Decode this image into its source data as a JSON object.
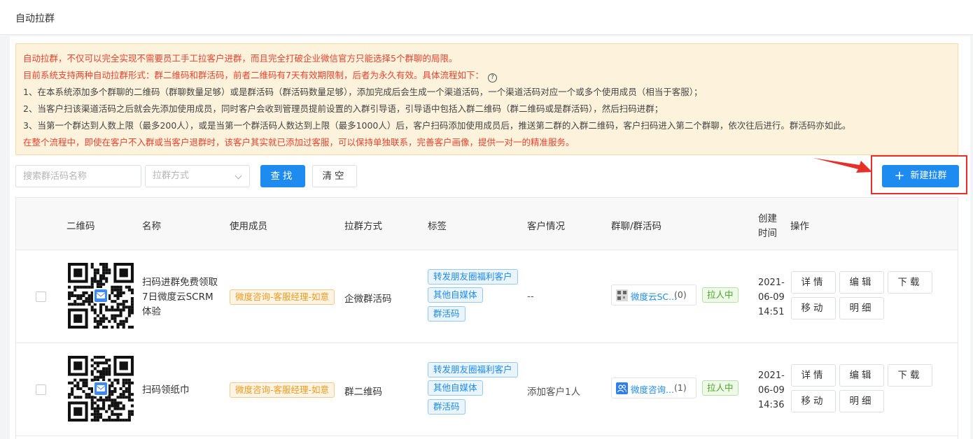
{
  "page": {
    "title": "自动拉群"
  },
  "notice": {
    "line1": "自动拉群，不仅可以完全实现不需要员工手工拉客户进群，而且完全打破企业微信官方只能选择5个群聊的局限。",
    "line2": "目前系统支持两种自动拉群形式：群二维码和群活码，前者二维码有7天有效期限制，后者为永久有效。具体流程如下：",
    "help_icon": "?",
    "line3": "1、在本系统添加多个群聊的二维码（群聊数量足够）或是群活码（群活码数量足够），添加完成后会生成一个渠道活码，一个渠道活码对应一个或多个使用成员（相当于客服）；",
    "line4": "2、当客户扫该渠道活码之后就会先添加使用成员，同时客户会收到管理员提前设置的入群引导语，引导语中包括入群二维码（群二维码或是群活码），然后扫码进群；",
    "line5": "3、当第一个群达到人数上限（最多200人），或是当第一个群活码人数达到上限（最多1000人）后，客户扫码添加使用成员后，推送第二群的入群二维码，客户扫码进入第二个群聊，依次往后进行。群活码亦如此。",
    "line6": "在整个流程中，即使在客户不入群或当客户退群时，该客户其实就已添加过客服，可以保持单独联系，完善客户画像，提供一对一的精准服务。",
    "colors": {
      "red": "#e8432e",
      "background": "#fdf2dc"
    }
  },
  "filters": {
    "search_placeholder": "搜索群活码名称",
    "method_placeholder": "拉群方式",
    "find_label": "查找",
    "clear_label": "清空",
    "new_label": "新建拉群"
  },
  "table": {
    "headers": {
      "qrcode": "二维码",
      "name": "名称",
      "members": "使用成员",
      "method": "拉群方式",
      "tags": "标签",
      "customer": "客户情况",
      "group": "群聊/群活码",
      "created_line1": "创建",
      "created_line2": "时间",
      "actions": "操作"
    },
    "rows": [
      {
        "name_line1": "扫码进群免费领取",
        "name_line2": "7日微度云SCRM",
        "name_line3": "体验",
        "member": "微度咨询-客服经理-如意",
        "method": "企微群活码",
        "tags": [
          "转发朋友圈福利客户",
          "其他自媒体",
          "群活码"
        ],
        "customer": "--",
        "group_name": "微度云SC...",
        "group_count": "(0)",
        "group_icon": "qr-thumbnail-icon",
        "status": "拉人中",
        "date_year": "2021-",
        "date_md": "06-09",
        "date_time": "14:51",
        "actions": [
          "详情",
          "编辑",
          "下载",
          "移动",
          "明细"
        ]
      },
      {
        "name_line1": "扫码领纸巾",
        "member": "微度咨询-客服经理-如意",
        "method": "群二维码",
        "tags": [
          "转发朋友圈福利客户",
          "其他自媒体",
          "群活码"
        ],
        "customer": "添加客户1人",
        "group_name": "微度咨询...",
        "group_count": "(1)",
        "group_icon": "group-chat-icon",
        "status": "拉人中",
        "date_year": "2021-",
        "date_md": "06-09",
        "date_time": "14:36",
        "actions": [
          "详情",
          "编辑",
          "下载",
          "移动",
          "明细"
        ]
      }
    ]
  },
  "colors": {
    "primary": "#1e8bf0",
    "highlight_red": "#e8302a",
    "status_green": "#48a527",
    "member_orange": "#f09a1b"
  }
}
